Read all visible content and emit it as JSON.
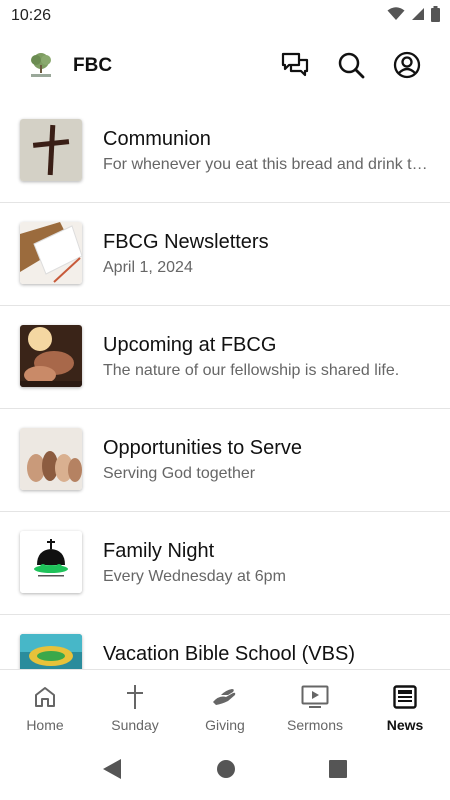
{
  "status_bar": {
    "time": "10:26"
  },
  "app_bar": {
    "title": "FBC"
  },
  "feed": [
    {
      "title": "Communion",
      "subtitle": "For whenever you eat this bread and drink this cup, you proclaim the Lord's death until he comes."
    },
    {
      "title": "FBCG Newsletters",
      "subtitle": "April 1, 2024"
    },
    {
      "title": "Upcoming at FBCG",
      "subtitle": "The nature of our fellowship is shared life."
    },
    {
      "title": "Opportunities to Serve",
      "subtitle": "Serving God together"
    },
    {
      "title": "Family Night",
      "subtitle": "Every Wednesday at 6pm"
    },
    {
      "title": "Vacation Bible School (VBS)",
      "subtitle": ""
    }
  ],
  "bottom_nav": [
    {
      "label": "Home",
      "icon": "home-icon"
    },
    {
      "label": "Sunday",
      "icon": "cross-icon"
    },
    {
      "label": "Giving",
      "icon": "giving-hand-icon"
    },
    {
      "label": "Sermons",
      "icon": "video-icon"
    },
    {
      "label": "News",
      "icon": "newspaper-icon",
      "active": true
    }
  ]
}
